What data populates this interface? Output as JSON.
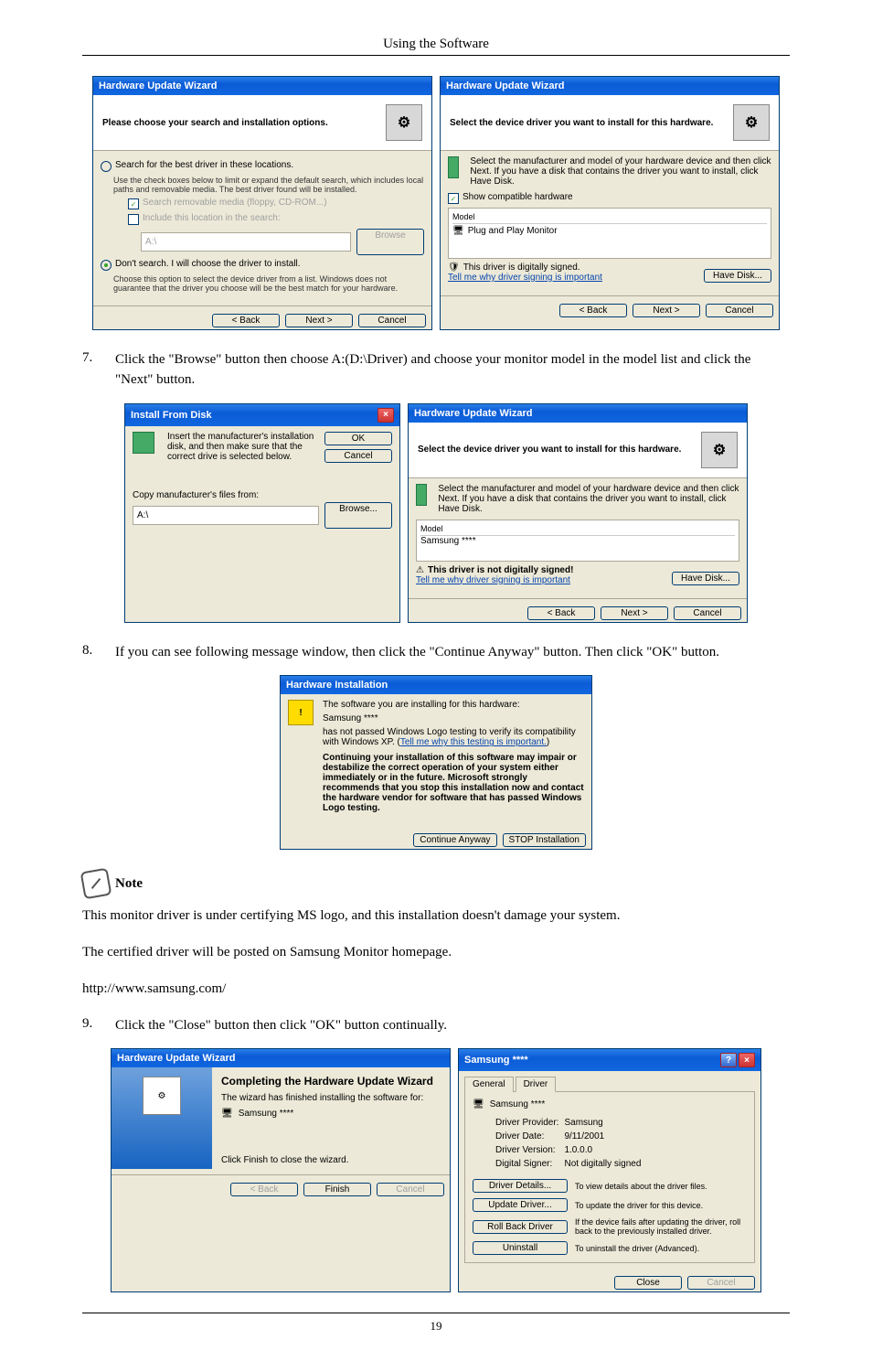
{
  "page_title": "Using the Software",
  "page_number": "19",
  "step7": {
    "num": "7.",
    "text": "Click the \"Browse\" button then choose A:(D:\\Driver) and choose your monitor model in the model list and click the \"Next\" button."
  },
  "step8": {
    "num": "8.",
    "text": "If you can see following message window, then click the \"Continue Anyway\" button. Then click \"OK\" button."
  },
  "step9": {
    "num": "9.",
    "text": "Click the \"Close\" button then click \"OK\" button continually."
  },
  "note_heading": "Note",
  "note_p1": "This monitor driver is under certifying MS logo, and this installation doesn't damage your system.",
  "note_p2": "The certified driver will be posted on Samsung Monitor homepage.",
  "note_url": "http://www.samsung.com/",
  "d1": {
    "title": "Hardware Update Wizard",
    "hdr": "Please choose your search and installation options.",
    "r1": "Search for the best driver in these locations.",
    "r1_desc": "Use the check boxes below to limit or expand the default search, which includes local paths and removable media. The best driver found will be installed.",
    "chk1": "Search removable media (floppy, CD-ROM...)",
    "chk2": "Include this location in the search:",
    "path": "A:\\",
    "browse": "Browse",
    "r2": "Don't search. I will choose the driver to install.",
    "r2_desc": "Choose this option to select the device driver from a list. Windows does not guarantee that the driver you choose will be the best match for your hardware.",
    "back": "< Back",
    "next": "Next >",
    "cancel": "Cancel"
  },
  "d2": {
    "title": "Hardware Update Wizard",
    "hdr": "Select the device driver you want to install for this hardware.",
    "desc": "Select the manufacturer and model of your hardware device and then click Next. If you have a disk that contains the driver you want to install, click Have Disk.",
    "chk": "Show compatible hardware",
    "model_hdr": "Model",
    "model_item": "Plug and Play Monitor",
    "signed": "This driver is digitally signed.",
    "tell": "Tell me why driver signing is important",
    "have": "Have Disk...",
    "back": "< Back",
    "next": "Next >",
    "cancel": "Cancel"
  },
  "d3": {
    "title": "Install From Disk",
    "msg": "Insert the manufacturer's installation disk, and then make sure that the correct drive is selected below.",
    "ok": "OK",
    "cancel": "Cancel",
    "copy": "Copy manufacturer's files from:",
    "path": "A:\\",
    "browse": "Browse..."
  },
  "d4": {
    "title": "Hardware Update Wizard",
    "hdr": "Select the device driver you want to install for this hardware.",
    "desc": "Select the manufacturer and model of your hardware device and then click Next. If you have a disk that contains the driver you want to install, click Have Disk.",
    "model_hdr": "Model",
    "model_item": "Samsung ****",
    "unsigned": "This driver is not digitally signed!",
    "tell": "Tell me why driver signing is important",
    "have": "Have Disk...",
    "back": "< Back",
    "next": "Next >",
    "cancel": "Cancel"
  },
  "d5": {
    "title": "Hardware Installation",
    "l1": "The software you are installing for this hardware:",
    "l2": "Samsung ****",
    "l3": "has not passed Windows Logo testing to verify its compatibility with Windows XP. (",
    "l3_link": "Tell me why this testing is important.",
    "l3_end": ")",
    "l4": "Continuing your installation of this software may impair or destabilize the correct operation of your system either immediately or in the future. Microsoft strongly recommends that you stop this installation now and contact the hardware vendor for software that has passed Windows Logo testing.",
    "cont": "Continue Anyway",
    "stop": "STOP Installation"
  },
  "d6": {
    "title": "Hardware Update Wizard",
    "hdr": "Completing the Hardware Update Wizard",
    "desc": "The wizard has finished installing the software for:",
    "dev": "Samsung ****",
    "fin": "Click Finish to close the wizard.",
    "back": "< Back",
    "finish": "Finish",
    "cancel": "Cancel"
  },
  "d7": {
    "title": "Samsung ****",
    "tab1": "General",
    "tab2": "Driver",
    "dev": "Samsung ****",
    "lblProv": "Driver Provider:",
    "valProv": "Samsung",
    "lblDate": "Driver Date:",
    "valDate": "9/11/2001",
    "lblVer": "Driver Version:",
    "valVer": "1.0.0.0",
    "lblSig": "Digital Signer:",
    "valSig": "Not digitally signed",
    "b1": "Driver Details...",
    "b1d": "To view details about the driver files.",
    "b2": "Update Driver...",
    "b2d": "To update the driver for this device.",
    "b3": "Roll Back Driver",
    "b3d": "If the device fails after updating the driver, roll back to the previously installed driver.",
    "b4": "Uninstall",
    "b4d": "To uninstall the driver (Advanced).",
    "close": "Close",
    "cancel": "Cancel"
  }
}
